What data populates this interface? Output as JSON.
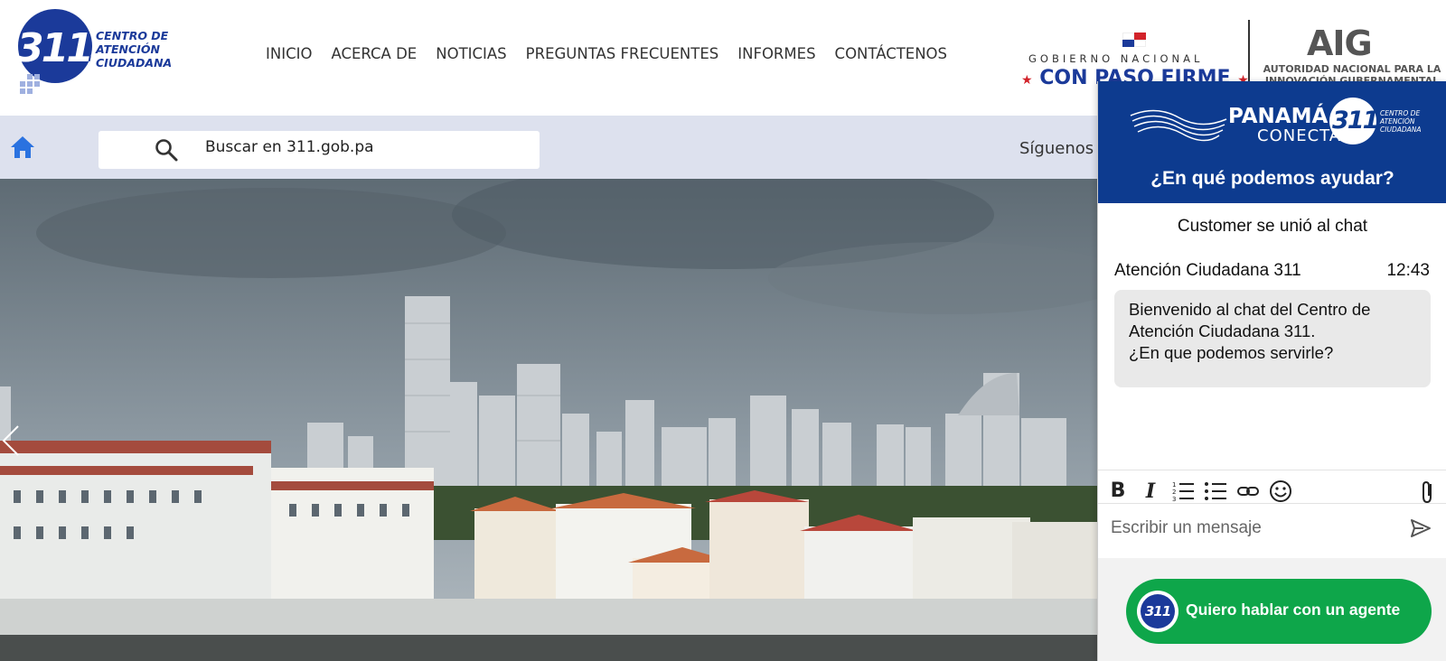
{
  "site": {
    "logo": {
      "number": "311",
      "text_lines": [
        "CENTRO DE",
        "ATENCIÓN",
        "CIUDADANA"
      ]
    },
    "nav": [
      {
        "label": "INICIO"
      },
      {
        "label": "ACERCA DE"
      },
      {
        "label": "NOTICIAS"
      },
      {
        "label": "PREGUNTAS FRECUENTES"
      },
      {
        "label": "INFORMES"
      },
      {
        "label": "CONTÁCTENOS"
      }
    ],
    "government": {
      "line1": "GOBIERNO NACIONAL",
      "line2": "CON PASO FIRME",
      "star": "★"
    },
    "aig": {
      "title": "AIG",
      "subtitle": "AUTORIDAD NACIONAL PARA LA INNOVACIÓN GUBERNAMENTAL"
    }
  },
  "search": {
    "placeholder": "Buscar en 311.gob.pa"
  },
  "social": {
    "label": "Síguenos"
  },
  "chat": {
    "brand": "PANAMÁ",
    "brand_sub": "CONECTA",
    "logo_number": "311",
    "logo_text": "CENTRO DE ATENCIÓN CIUDADANA",
    "help_title": "¿En qué podemos ayudar?",
    "system_message": "Customer se unió al chat",
    "message": {
      "sender": "Atención Ciudadana 311",
      "time": "12:43",
      "lines": [
        "Bienvenido al chat del Centro de",
        "Atención Ciudadana 311.",
        "¿En que podemos servirle?"
      ]
    },
    "toolbar": {
      "bold": "B",
      "italic": "I"
    },
    "input_placeholder": "Escribir un mensaje",
    "agent_button": "Quiero hablar con un agente"
  },
  "colors": {
    "brand_blue": "#1b3a9a",
    "chat_header": "#0d3b8f",
    "agent_green": "#0ea64a",
    "searchbar_bg": "#dde1ee",
    "home_icon": "#2a72e0"
  }
}
